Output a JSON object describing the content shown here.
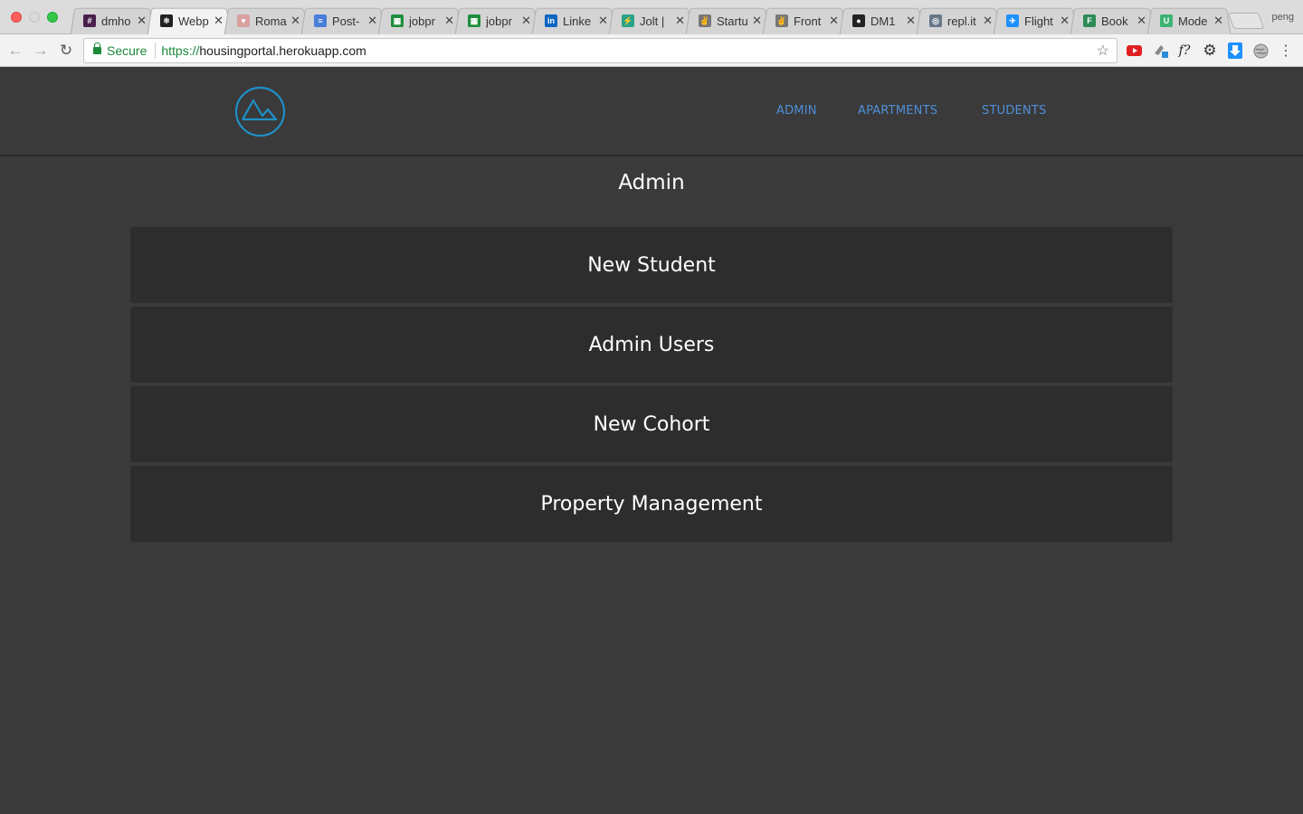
{
  "browser": {
    "tabs": [
      {
        "title": "dmho",
        "fav_color": "#4a1f4a",
        "fav_glyph": "#",
        "active": false
      },
      {
        "title": "Webp",
        "fav_color": "#222222",
        "fav_glyph": "⚛",
        "active": true
      },
      {
        "title": "Roma",
        "fav_color": "#d9a0a0",
        "fav_glyph": "♥",
        "active": false
      },
      {
        "title": "Post-",
        "fav_color": "#4a7fd9",
        "fav_glyph": "≡",
        "active": false
      },
      {
        "title": "jobpr",
        "fav_color": "#1e8e3e",
        "fav_glyph": "▦",
        "active": false
      },
      {
        "title": "jobpr",
        "fav_color": "#1e8e3e",
        "fav_glyph": "▦",
        "active": false
      },
      {
        "title": "Linke",
        "fav_color": "#0a66c2",
        "fav_glyph": "in",
        "active": false
      },
      {
        "title": "Jolt |",
        "fav_color": "#2aa38a",
        "fav_glyph": "⚡",
        "active": false
      },
      {
        "title": "Startu",
        "fav_color": "#777777",
        "fav_glyph": "✌",
        "active": false
      },
      {
        "title": "Front",
        "fav_color": "#777777",
        "fav_glyph": "✌",
        "active": false
      },
      {
        "title": "DM1",
        "fav_color": "#222222",
        "fav_glyph": "●",
        "active": false
      },
      {
        "title": "repl.it",
        "fav_color": "#667788",
        "fav_glyph": "◎",
        "active": false
      },
      {
        "title": "Flight",
        "fav_color": "#1e90ff",
        "fav_glyph": "✈",
        "active": false
      },
      {
        "title": "Book",
        "fav_color": "#2e8b57",
        "fav_glyph": "F",
        "active": false
      },
      {
        "title": "Mode",
        "fav_color": "#3cb371",
        "fav_glyph": "U",
        "active": false
      }
    ],
    "profile": "peng",
    "secure_label": "Secure",
    "url_scheme": "https://",
    "url_host": "housingportal.herokuapp.com",
    "icons": {
      "back": "arrow-left-icon",
      "forward": "arrow-right-icon",
      "reload": "reload-icon",
      "star": "bookmark-star-icon"
    }
  },
  "site": {
    "logo": "mountain-logo-icon",
    "accent_color": "#4f8fd9",
    "logo_color": "#1e90c8",
    "nav": [
      "ADMIN",
      "APARTMENTS",
      "STUDENTS"
    ],
    "page_title": "Admin",
    "menu": [
      "New Student",
      "Admin Users",
      "New Cohort",
      "Property Management"
    ]
  }
}
